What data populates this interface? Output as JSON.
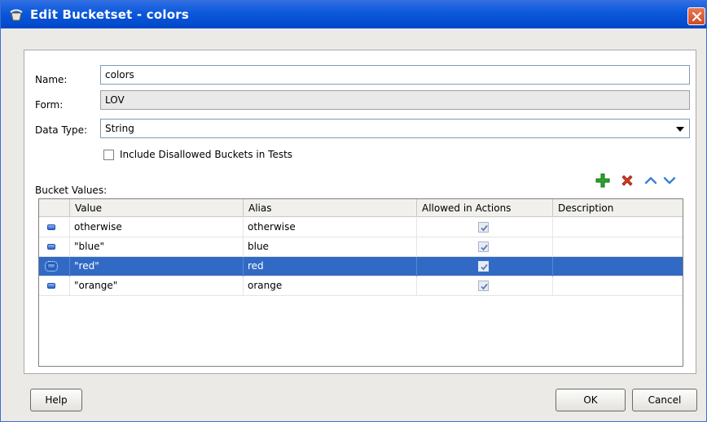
{
  "window": {
    "title": "Edit Bucketset - colors",
    "title_icon": "bucketset-icon",
    "close_icon": "close-icon"
  },
  "form": {
    "name_label": "Name:",
    "name_value": "colors",
    "form_label": "Form:",
    "form_value": "LOV",
    "datatype_label": "Data Type:",
    "datatype_value": "String",
    "include_disallowed_label": "Include Disallowed Buckets in Tests",
    "include_disallowed_checked": false
  },
  "bucket_values": {
    "label": "Bucket Values:",
    "toolbar": {
      "add_icon": "plus-icon",
      "delete_icon": "delete-x-icon",
      "move_up_icon": "chevron-up-icon",
      "move_down_icon": "chevron-down-icon"
    },
    "columns": [
      "",
      "Value",
      "Alias",
      "Allowed in Actions",
      "Description"
    ],
    "rows": [
      {
        "value": "otherwise",
        "alias": "otherwise",
        "allowed": true,
        "description": "",
        "selected": false
      },
      {
        "value": "\"blue\"",
        "alias": "blue",
        "allowed": true,
        "description": "",
        "selected": false
      },
      {
        "value": "\"red\"",
        "alias": "red",
        "allowed": true,
        "description": "",
        "selected": true
      },
      {
        "value": "\"orange\"",
        "alias": "orange",
        "allowed": true,
        "description": "",
        "selected": false
      }
    ]
  },
  "footer": {
    "help_label": "Help",
    "ok_label": "OK",
    "cancel_label": "Cancel"
  },
  "colors": {
    "titlebar": "#0b58d9",
    "selection": "#316ac5",
    "add_green": "#2aa52a",
    "delete_red": "#d93a1e",
    "arrow_blue": "#3d7fd6"
  }
}
